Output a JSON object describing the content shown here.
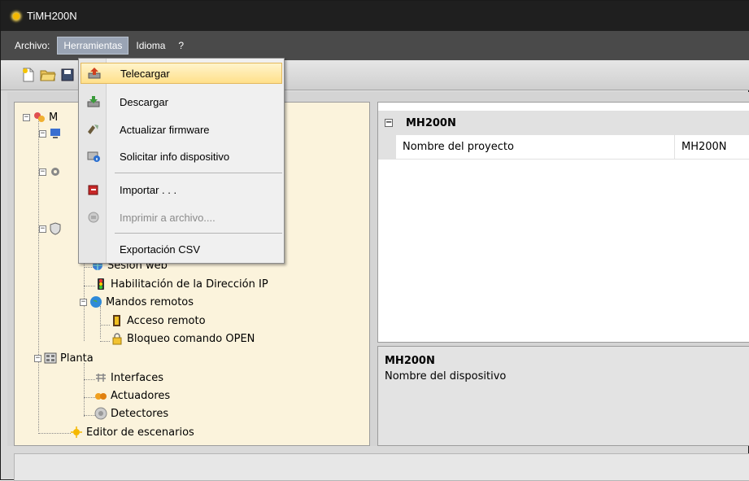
{
  "window": {
    "title": "TiMH200N"
  },
  "menubar": {
    "items": [
      {
        "label": "Archivo:"
      },
      {
        "label": "Herramientas"
      },
      {
        "label": "Idioma"
      },
      {
        "label": "?"
      }
    ]
  },
  "dropdown": {
    "items": [
      {
        "label": "Telecargar",
        "icon": "upload-icon",
        "highlighted": true
      },
      {
        "label": "Descargar",
        "icon": "download-icon"
      },
      {
        "label": "Actualizar firmware",
        "icon": "firmware-icon"
      },
      {
        "label": "Solicitar info dispositivo",
        "icon": "device-info-icon"
      },
      {
        "label": "Importar . . .",
        "icon": "import-icon"
      },
      {
        "label": "Imprimir a archivo....",
        "icon": "print-icon",
        "disabled": true
      },
      {
        "label": "Exportación CSV",
        "icon": ""
      }
    ]
  },
  "tree": {
    "root_label": "M",
    "items": [
      {
        "label": "Sesión web"
      },
      {
        "label": "Habilitación de la Dirección IP"
      },
      {
        "label": "Mandos remotos"
      },
      {
        "label": "Acceso remoto"
      },
      {
        "label": "Bloqueo comando OPEN"
      },
      {
        "label": "Planta"
      },
      {
        "label": "Interfaces"
      },
      {
        "label": "Actuadores"
      },
      {
        "label": "Detectores"
      },
      {
        "label": "Editor de escenarios"
      }
    ]
  },
  "properties": {
    "section": "MH200N",
    "rows": [
      {
        "name": "Nombre del proyecto",
        "value": "MH200N"
      }
    ]
  },
  "description": {
    "title": "MH200N",
    "text": "Nombre del dispositivo"
  },
  "colors": {
    "titlebar": "#1f1f1f",
    "menubar": "#4a4a4a",
    "tree_bg": "#fbf3dc",
    "highlight": "#ffe08a"
  }
}
